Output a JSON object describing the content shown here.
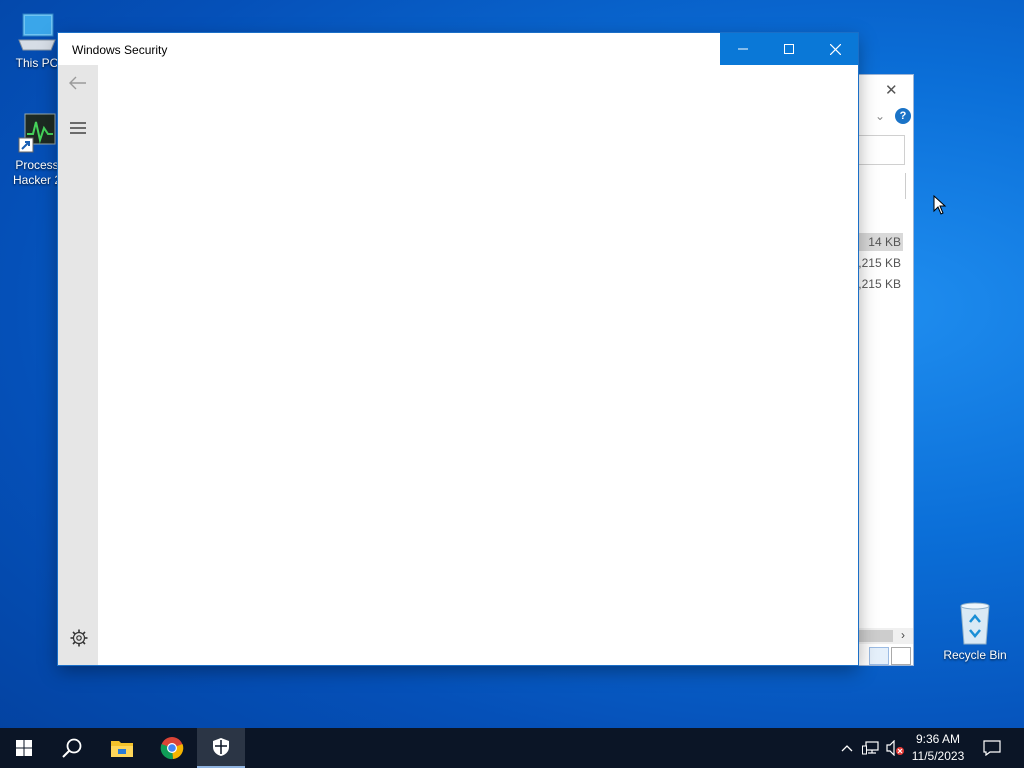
{
  "desktop": {
    "icons": [
      {
        "label": "This PC"
      },
      {
        "label": "Process Hacker 2"
      },
      {
        "label": "Recycle Bin"
      }
    ]
  },
  "background_window": {
    "sizes": [
      "14 KB",
      ",215 KB",
      ",215 KB"
    ],
    "help_label": "?"
  },
  "window": {
    "title": "Windows Security",
    "accent_color": "#0a78d7"
  },
  "taskbar": {
    "time": "9:36 AM",
    "date": "11/5/2023",
    "apps": [
      {
        "name": "Search"
      },
      {
        "name": "File Explorer"
      },
      {
        "name": "Google Chrome"
      },
      {
        "name": "Windows Security"
      }
    ]
  }
}
